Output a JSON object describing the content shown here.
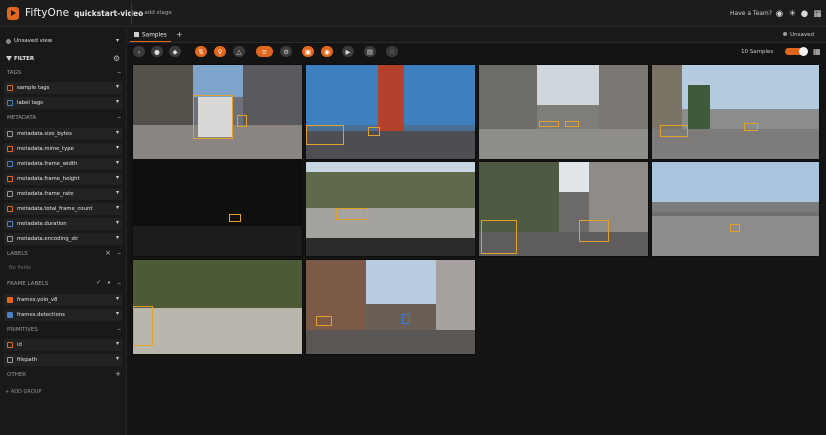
{
  "header": {
    "brand": "FiftyOne",
    "dataset": "quickstart-video",
    "add_stage": "+ add stage",
    "team_link": "Have a Team?",
    "icons": [
      "team-icon",
      "theme-icon",
      "github-icon",
      "help-icon"
    ]
  },
  "sidebar": {
    "view_select": "Unsaved view",
    "filter_title": "FILTER",
    "groups": {
      "tags": "TAGS",
      "metadata": "METADATA",
      "labels": "LABELS",
      "no_fields": "No fields",
      "frame_labels": "FRAME LABELS",
      "primitives": "PRIMITIVES",
      "other": "OTHER"
    },
    "tags_items": [
      {
        "label": "sample tags"
      },
      {
        "label": "label tags"
      }
    ],
    "metadata_items": [
      {
        "label": "metadata.size_bytes"
      },
      {
        "label": "metadata.mime_type"
      },
      {
        "label": "metadata.frame_width"
      },
      {
        "label": "metadata.frame_height"
      },
      {
        "label": "metadata.frame_rate"
      },
      {
        "label": "metadata.total_frame_count"
      },
      {
        "label": "metadata.duration"
      },
      {
        "label": "metadata.encoding_str"
      }
    ],
    "frame_label_items": [
      {
        "label": "frames.yolo_v8",
        "checked": true
      },
      {
        "label": "frames.detections",
        "checked": true
      }
    ],
    "primitive_items": [
      {
        "label": "id"
      },
      {
        "label": "filepath"
      }
    ],
    "add_group": "+ ADD GROUP"
  },
  "tabs": {
    "samples": "Samples",
    "unsaved": "Unsaved"
  },
  "toolbar": {
    "sample_count": "10 Samples",
    "buttons": [
      "back-icon",
      "color-icon",
      "tag-icon",
      "sort-icon",
      "search-icon",
      "similarity-icon",
      "list-icon",
      "settings-icon",
      "fit-icon",
      "color-by-icon",
      "video-icon",
      "histogram-icon",
      "embeddings-icon"
    ]
  },
  "colors": {
    "accent": "#e2671e",
    "detection_box": "#e2a12a",
    "secondary_box": "#3b7bd4"
  },
  "samples": [
    {
      "scene": "city-street-truck"
    },
    {
      "scene": "golden-gate-bridge"
    },
    {
      "scene": "downtown-intersection"
    },
    {
      "scene": "palm-tree-avenue"
    },
    {
      "scene": "night-road"
    },
    {
      "scene": "dashboard-hill-road"
    },
    {
      "scene": "parked-cars-street"
    },
    {
      "scene": "freeway-overpass"
    },
    {
      "scene": "tree-lined-road"
    },
    {
      "scene": "city-construction-street"
    }
  ]
}
